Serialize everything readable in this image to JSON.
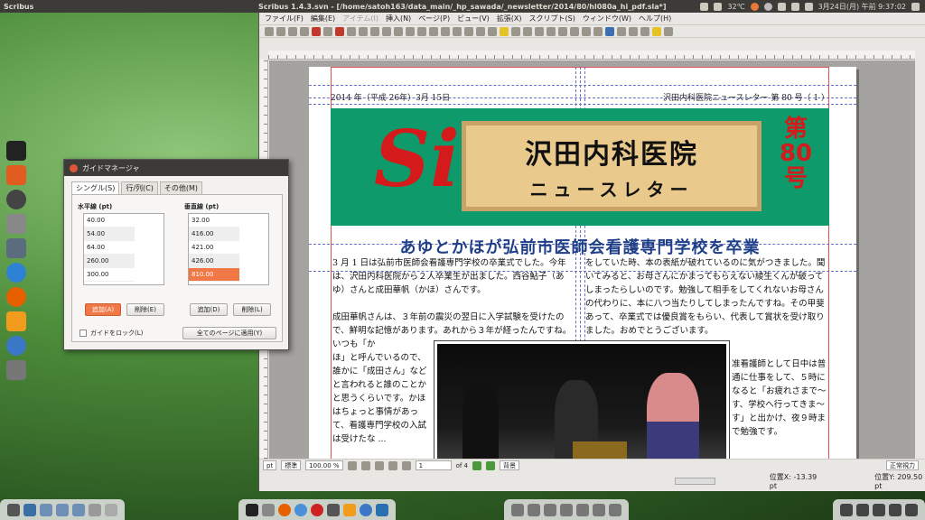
{
  "top_panel": {
    "app_name": "Scribus",
    "window_title": "Scribus 1.4.3.svn - [/home/satoh163/data_main/_hp_sawada/_newsletter/2014/80/hl080a_hi_pdf.sla*]",
    "temperature": "32℃",
    "datetime": "3月24日(月) 午前 9:37:02"
  },
  "menubar": {
    "items": [
      "ファイル(F)",
      "編集(E)",
      "アイテム(I)",
      "挿入(N)",
      "ページ(P)",
      "ビュー(V)",
      "拡張(X)",
      "スクリプト(S)",
      "ウィンドウ(W)",
      "ヘルプ(H)"
    ]
  },
  "newsletter": {
    "date": "2014 年（平成 26年）3月 15日",
    "masthead": "沢田内科医院ニュースレター 第 80 号（ 1 ）",
    "logo_text": "Si",
    "title_main": "沢田内科医院",
    "title_sub": "ニュースレター",
    "issue": [
      "第",
      "80",
      "号"
    ],
    "headline": "あゆとかほが弘前市医師会看護専門学校を卒業",
    "col1_p1": "3 月 1 日は弘前市医師会看護専門学校の卒業式でした。今年は、沢田内科医院から２人卒業生が出ました。西谷鮎子（あゆ）さんと成田華帆（かほ）さんです。",
    "col1_p2": "成田華帆さんは、３年前の震災の翌日に入学試験を受けたので、鮮明な記憶があります。あれから３年が経ったんですね。いつも「か",
    "col1_p3": "ほ」と呼んでいるので、誰かに「成田さん」などと言われると誰のことかと思うくらいです。かほはちょっと事情があって、看護専門学校の入試は受けたな ...",
    "col2_p1": "をしていた時、本の表紙が破れているのに気がつきました。聞いてみると、お母さんにかまってもらえない綾生くんが破ってしまったらしいのです。勉強して相手をしてくれないお母さんの代わりに、本に八つ当たりしてしまったんですね。その甲斐あって、卒業式では優良賞をもらい、代表して賞状を受け取りました。おめでとうございます。",
    "col2_p2": "准看護師として日中は普通に仕事をして、５時になると「お疲れさまで～す、学校へ行ってきま～す」と出かけ、夜９時まで勉強です。"
  },
  "statusbar": {
    "unit": "pt",
    "mode": "標準",
    "zoom": "100.00 %",
    "page": "1",
    "of_pages": "of 4",
    "layer": "背景",
    "view": "正常視力",
    "pos_x": "位置X:  -13.39 pt",
    "pos_y": "位置Y:  209.50 pt"
  },
  "guide_dialog": {
    "title": "ガイドマネージャ",
    "tabs": [
      "シングル(S)",
      "行/列(C)",
      "その他(M)"
    ],
    "horizontal_label": "水平線 (pt)",
    "vertical_label": "垂直線 (pt)",
    "horizontal": [
      "40.00",
      "54.00",
      "64.00",
      "260.00",
      "300.00"
    ],
    "vertical": [
      "32.00",
      "416.00",
      "421.00",
      "426.00",
      "810.00"
    ],
    "add_label": "追加(A)",
    "delete_label": "削除(E)",
    "add_label_v": "追加(D)",
    "delete_label_v": "削除(L)",
    "lock_label": "ガイドをロック(L)",
    "apply_label": "全てのページに適用(Y)"
  }
}
